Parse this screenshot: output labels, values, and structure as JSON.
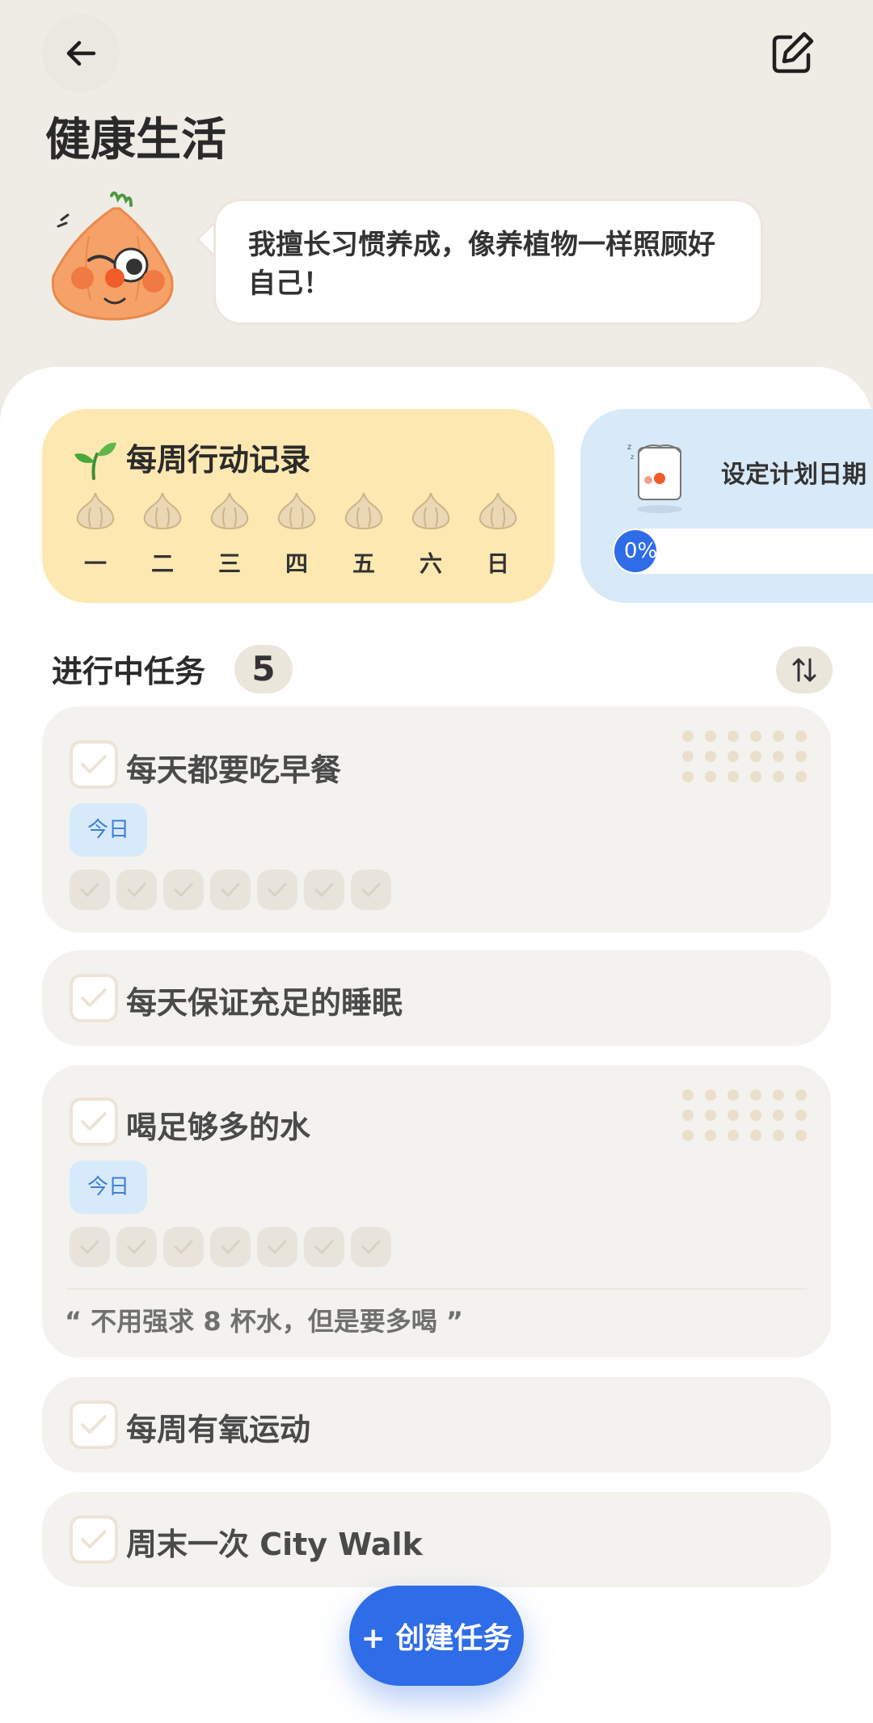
{
  "header": {
    "title": "健康生活"
  },
  "mascot": {
    "speech": "我擅长习惯养成，像养植物一样照顾好自己！"
  },
  "weekly_record": {
    "title": "每周行动记录",
    "days": [
      "一",
      "二",
      "三",
      "四",
      "五",
      "六",
      "日"
    ]
  },
  "plan_card": {
    "text": "设定计划日期",
    "progress_label": "0%"
  },
  "tasks_section": {
    "title": "进行中任务",
    "count": "5"
  },
  "tasks": [
    {
      "title": "每天都要吃早餐",
      "tag": "今日"
    },
    {
      "title": "每天保证充足的睡眠"
    },
    {
      "title": "喝足够多的水",
      "tag": "今日",
      "note": "“ 不用强求 8 杯水，但是要多喝 ”"
    },
    {
      "title": "每周有氧运动"
    },
    {
      "title": "周末一次 City Walk"
    }
  ],
  "create_button": {
    "label": "+ 创建任务"
  },
  "colors": {
    "accent": "#2f6ce7",
    "weekly_bg": "#fde8b1",
    "plan_bg": "#d8e9f8",
    "card_bg": "#f4f2ee"
  }
}
